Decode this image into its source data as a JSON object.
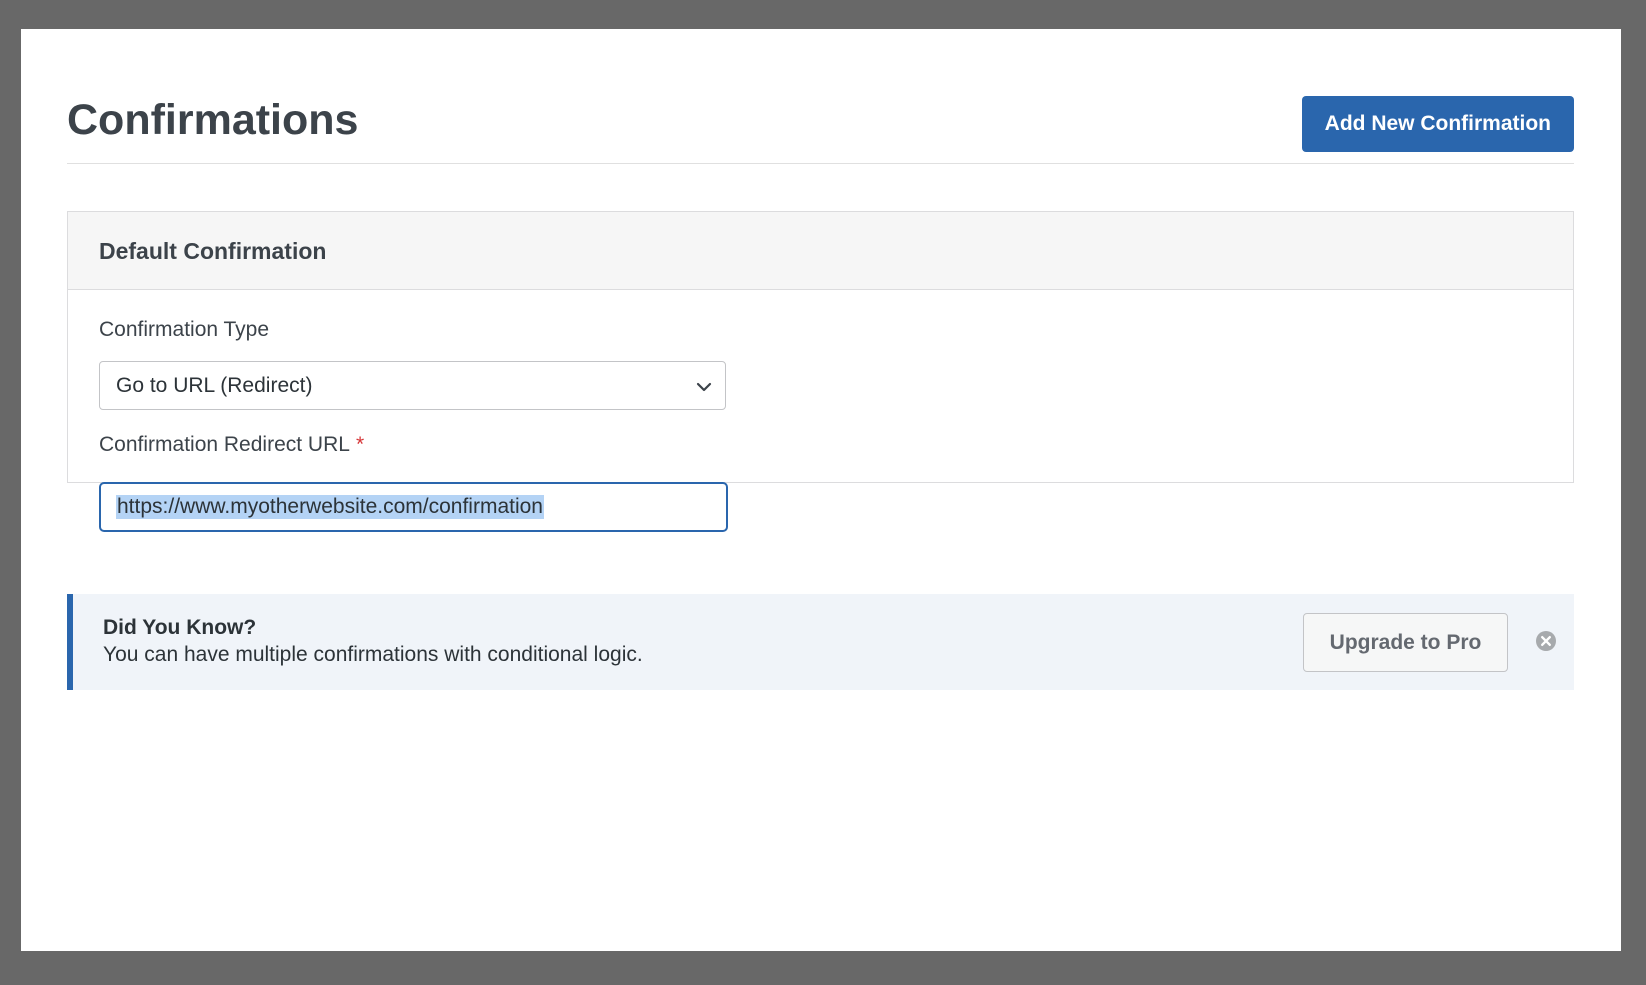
{
  "header": {
    "title": "Confirmations",
    "add_button_label": "Add New Confirmation"
  },
  "panel": {
    "title": "Default Confirmation",
    "type_label": "Confirmation Type",
    "type_value": "Go to URL (Redirect)",
    "url_label": "Confirmation Redirect URL",
    "required_marker": "*",
    "url_value": "https://www.myotherwebsite.com/confirmation"
  },
  "notice": {
    "title": "Did You Know?",
    "text": "You can have multiple confirmations with conditional logic.",
    "upgrade_label": "Upgrade to Pro"
  },
  "colors": {
    "accent": "#2a66ad",
    "required": "#d63638",
    "notice_bg": "#f0f4f9"
  },
  "icons": {
    "select": "chevron-down-icon",
    "dismiss": "close-circle-icon"
  }
}
